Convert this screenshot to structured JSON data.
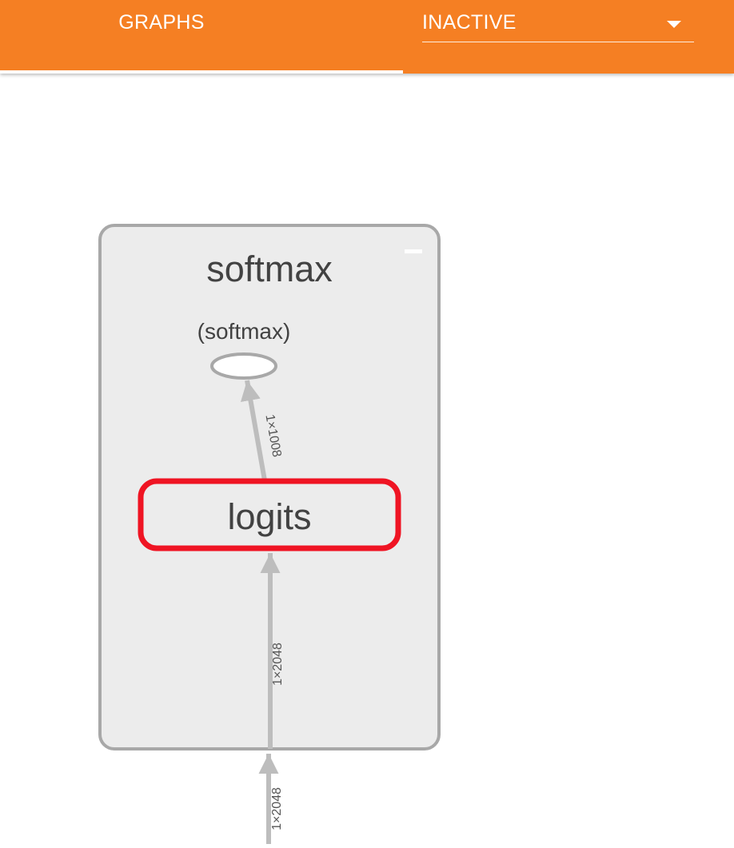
{
  "header": {
    "tab_label": "GRAPHS",
    "run_select_value": "INACTIVE"
  },
  "graph": {
    "group_title": "softmax",
    "op_node_label": "(softmax)",
    "highlighted_node_label": "logits",
    "edges": {
      "logits_to_softmax": "1×1008",
      "inner_input": "1×2048",
      "outer_input": "1×2048"
    }
  },
  "colors": {
    "accent": "#f57f23",
    "group_fill": "#ececec",
    "group_border": "#a8a8a8",
    "edge": "#bdbdbd",
    "highlight": "#ef1423"
  },
  "icons": {
    "collapse": "minus-icon",
    "dropdown": "caret-down-icon"
  }
}
